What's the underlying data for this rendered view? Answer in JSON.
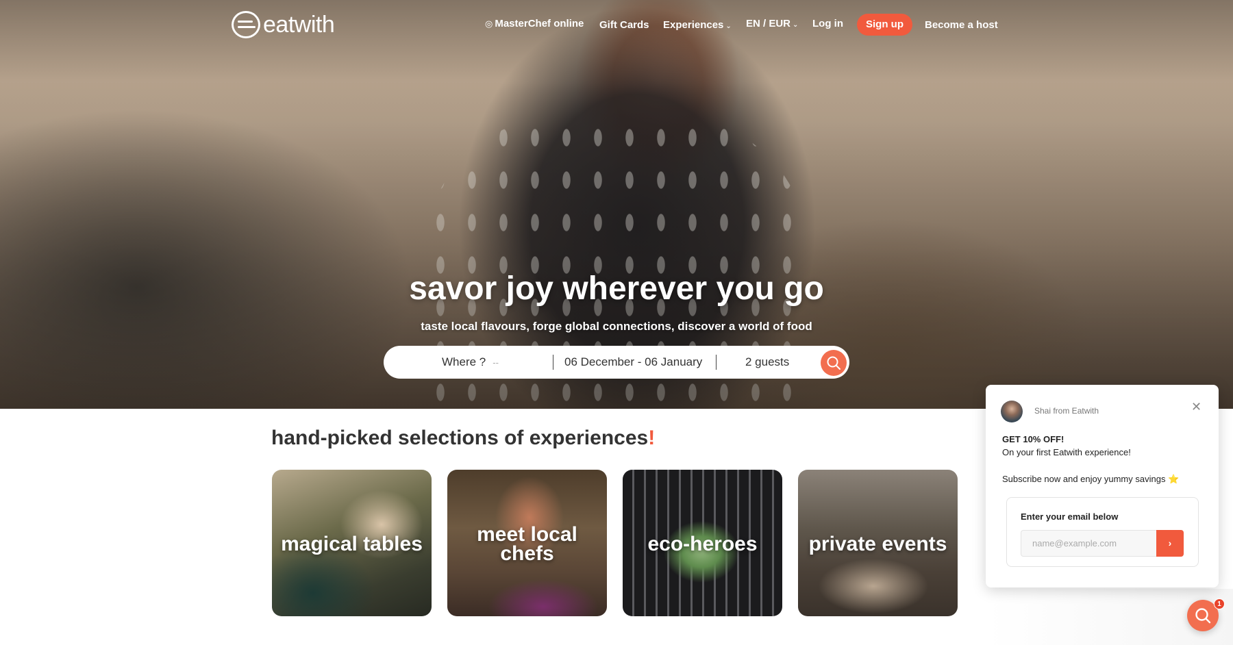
{
  "nav": {
    "logo_text": "eatwith",
    "masterchef": "MasterChef online",
    "gift_cards": "Gift Cards",
    "experiences": "Experiences",
    "language": "EN / EUR",
    "login": "Log in",
    "signup": "Sign up",
    "become_host": "Become a host"
  },
  "hero": {
    "headline": "savor joy wherever you go",
    "subline": "taste local flavours, forge global connections, discover a world of food"
  },
  "search": {
    "where": "Where ?",
    "where_dash": "--",
    "dates": "06 December - 06 January",
    "guests": "2 guests"
  },
  "section": {
    "title": "hand-picked selections of experiences",
    "accent": "!"
  },
  "cards": [
    {
      "line1": "magical tables",
      "line2": ""
    },
    {
      "line1": "meet local",
      "line2": "chefs"
    },
    {
      "line1": "eco-heroes",
      "line2": ""
    },
    {
      "line1": "private events",
      "line2": ""
    }
  ],
  "popup": {
    "from": "Shai from Eatwith",
    "heading": "GET 10% OFF!",
    "line1": "On your first Eatwith experience!",
    "line2": "Subscribe now and enjoy yummy savings ⭐",
    "email_label": "Enter your email below",
    "email_placeholder": "name@example.com",
    "submit": "›",
    "close": "✕"
  },
  "chat": {
    "badge": "1"
  },
  "colors": {
    "accent": "#f15a3d",
    "search_button": "#f26e4f"
  }
}
